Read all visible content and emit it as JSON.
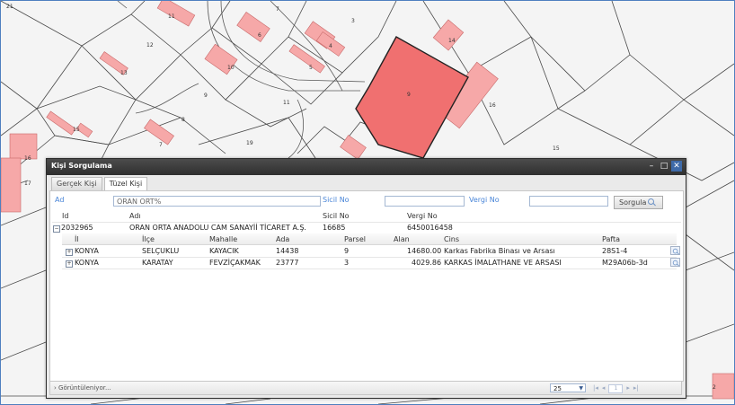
{
  "map": {
    "parcel_numbers": [
      "21",
      "11",
      "7",
      "3",
      "14",
      "12",
      "6",
      "4",
      "13",
      "10",
      "5",
      "9",
      "11",
      "16",
      "8",
      "15",
      "15",
      "16",
      "7",
      "19",
      "17",
      "2"
    ],
    "selected_parcel_color": "#f07070",
    "building_color": "#f6a8a8"
  },
  "dialog": {
    "title": "Kişi Sorgulama",
    "buttons": {
      "minimize": "–",
      "maximize": "□",
      "close": "✕"
    },
    "tabs": [
      "Gerçek Kişi",
      "Tüzel Kişi"
    ],
    "active_tab": "Tüzel Kişi",
    "search": {
      "ad_label": "Ad",
      "ad_value": "ORAN ORT%",
      "sicil_label": "Sicil No",
      "sicil_value": "",
      "vergi_label": "Vergi No",
      "vergi_value": "",
      "button_label": "Sorgula"
    },
    "grid": {
      "headers": {
        "id": "Id",
        "adi": "Adı",
        "sicil": "Sicil No",
        "vergi": "Vergi No"
      },
      "group_row": {
        "id": "2032965",
        "adi": "ORAN ORTA ANADOLU CAM SANAYİİ TİCARET A.Ş.",
        "sicil": "16685",
        "vergi": "6450016458"
      },
      "sub_headers": {
        "il": "İl",
        "ilce": "İlçe",
        "mahalle": "Mahalle",
        "ada": "Ada",
        "parsel": "Parsel",
        "alan": "Alan",
        "cins": "Cins",
        "pafta": "Pafta"
      },
      "rows": [
        {
          "il": "KONYA",
          "ilce": "SELÇUKLU",
          "mahalle": "KAYACIK",
          "ada": "14438",
          "parsel": "9",
          "alan": "14680.00",
          "cins": "Karkas Fabrika Binası ve Arsası",
          "pafta": "28S1-4"
        },
        {
          "il": "KONYA",
          "ilce": "KARATAY",
          "mahalle": "FEVZİÇAKMAK",
          "ada": "23777",
          "parsel": "3",
          "alan": "4029.86",
          "cins": "KARKAS İMALATHANE VE ARSASI",
          "pafta": "M29A06b-3d"
        }
      ]
    },
    "status": {
      "text": "› Görüntüleniyor...",
      "page_size": "25",
      "page_size_arrow": "▼",
      "pager": {
        "first": "|◂",
        "prev": "◂",
        "next": "▸",
        "last": "▸|",
        "current": "1"
      }
    }
  }
}
